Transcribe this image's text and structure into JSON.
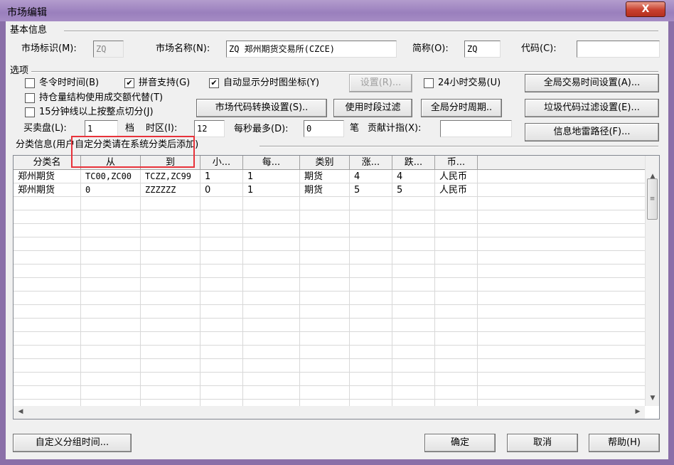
{
  "window": {
    "title": "市场编辑",
    "close_label": "X"
  },
  "basic": {
    "section": "基本信息",
    "market_id_label": "市场标识(M):",
    "market_id_value": "ZQ",
    "market_name_label": "市场名称(N):",
    "market_name_value": "ZQ 郑州期货交易所(CZCE)",
    "short_label": "简称(O):",
    "short_value": "ZQ",
    "code_label": "代码(C):",
    "code_value": ""
  },
  "options": {
    "section": "选项",
    "winter_time": {
      "label": "冬令时时间(B)",
      "checked": false
    },
    "pinyin": {
      "label": "拼音支持(G)",
      "checked": true
    },
    "auto_axis": {
      "label": "自动显示分时图坐标(Y)",
      "checked": true
    },
    "settings_button": "设置(R)...",
    "h24": {
      "label": "24小时交易(U)",
      "checked": false
    },
    "global_time_button": "全局交易时间设置(A)...",
    "position_struct": {
      "label": "持仓量结构使用成交额代替(T)",
      "checked": false
    },
    "min15": {
      "label": "15分钟线以上按整点切分(J)",
      "checked": false
    },
    "code_convert_button": "市场代码转换设置(S)..",
    "period_filter_button": "使用时段过滤",
    "global_period_button": "全局分时周期..",
    "junk_filter_button": "垃圾代码过滤设置(E)...",
    "depth_label": "买卖盘(L):",
    "depth_value": "1",
    "depth_unit": "档",
    "tz_label": "时区(I):",
    "tz_value": "12",
    "max_label": "每秒最多(D):",
    "max_value": "0",
    "max_unit": "笔",
    "contrib_label": "贡献计指(X):",
    "contrib_value": "",
    "info_path_button": "信息地雷路径(F)..."
  },
  "category": {
    "section": "分类信息(用户自定分类请在系统分类后添加)",
    "columns": [
      "分类名",
      "从",
      "到",
      "小...",
      "每...",
      "类别",
      "涨...",
      "跌...",
      "币..."
    ],
    "rows": [
      [
        "郑州期货",
        "TC00,ZC00",
        "TCZZ,ZC99",
        "1",
        "1",
        "期货",
        "4",
        "4",
        "人民币"
      ],
      [
        "郑州期货",
        "0",
        "ZZZZZZ",
        "0",
        "1",
        "期货",
        "5",
        "5",
        "人民币"
      ]
    ]
  },
  "footer": {
    "custom_group_button": "自定义分组时间...",
    "ok_button": "确定",
    "cancel_button": "取消",
    "help_button": "帮助(H)"
  },
  "colors": {
    "highlight": "#e8323a",
    "titlebar": "#9a7fbd"
  }
}
